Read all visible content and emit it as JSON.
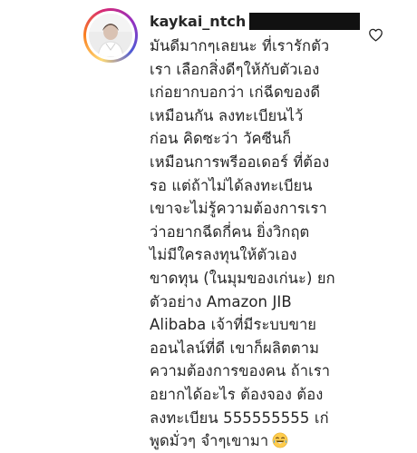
{
  "comment": {
    "username": "kaykai_ntch",
    "lines": [
      "มันดีมากๆเลยนะ ที่เรารักตัว",
      "เรา เลือกสิ่งดีๆให้กับตัวเอง",
      "เก่อยากบอกว่า เก่ฉีดของดี",
      "เหมือนกัน ลงทะเบียนไว้",
      "ก่อน คิดซะว่า วัคซีนก็",
      "เหมือนการพรีออเดอร์ ที่ต้อง",
      "รอ แต่ถ้าไม่ได้ลงทะเบียน",
      "เขาจะไม่รู้ความต้องการเรา",
      "ว่าอยากฉีดกี่คน ยิ่งวิกฤต",
      "ไม่มีใครลงทุนให้ตัวเอง",
      "ขาดทุน (ในมุมของเก่นะ) ยก",
      "ตัวอย่าง Amazon JIB",
      "Alibaba เจ้าที่มีระบบขาย",
      "ออนไลน์ที่ดี เขาก็ผลิตตาม",
      "ความต้องการของคน ถ้าเรา",
      "อยากได้อะไร ต้องจอง ต้อง",
      "ลงทะเบียน 555555555 เก่",
      "พูดมั่วๆ จำๆเขามา"
    ],
    "trailing_emoji": "laughing-tears-emoji"
  },
  "icons": {
    "like": "heart-outline-icon"
  },
  "colors": {
    "text": "#262626",
    "redaction": "#111111",
    "ring_gradient": [
      "#feda75",
      "#fa7e1e",
      "#d62976",
      "#962fbf",
      "#4f5bd5"
    ],
    "emoji_face": "#ffcc4d"
  }
}
